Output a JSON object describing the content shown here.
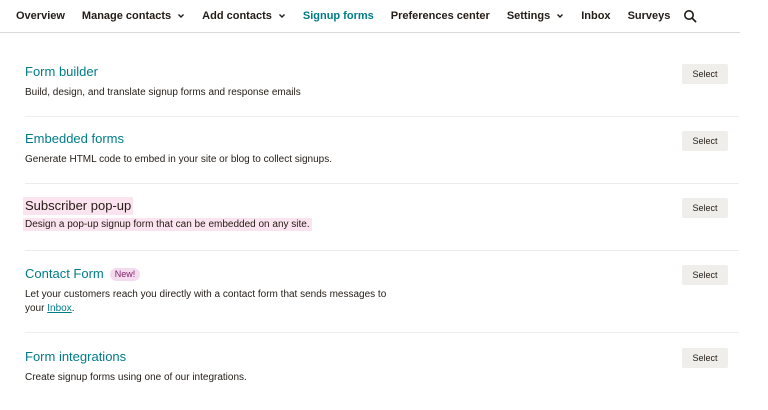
{
  "nav": {
    "items": [
      {
        "label": "Overview",
        "dropdown": false,
        "active": false
      },
      {
        "label": "Manage contacts",
        "dropdown": true,
        "active": false
      },
      {
        "label": "Add contacts",
        "dropdown": true,
        "active": false
      },
      {
        "label": "Signup forms",
        "dropdown": false,
        "active": true
      },
      {
        "label": "Preferences center",
        "dropdown": false,
        "active": false
      },
      {
        "label": "Settings",
        "dropdown": true,
        "active": false
      },
      {
        "label": "Inbox",
        "dropdown": false,
        "active": false
      },
      {
        "label": "Surveys",
        "dropdown": false,
        "active": false
      }
    ],
    "search_icon": "search-icon"
  },
  "forms": [
    {
      "title": "Form builder",
      "description": "Build, design, and translate signup forms and response emails",
      "button": "Select"
    },
    {
      "title": "Embedded forms",
      "description": "Generate HTML code to embed in your site or blog to collect signups.",
      "button": "Select"
    },
    {
      "title": "Subscriber pop-up",
      "description": "Design a pop-up signup form that can be embedded on any site.",
      "button": "Select",
      "highlighted": true
    },
    {
      "title": "Contact Form",
      "badge": "New!",
      "description_line1": "Let your customers reach you directly with a contact form that sends messages to",
      "description_line2_prefix": "your ",
      "description_link": "Inbox",
      "description_line2_suffix": ".",
      "button": "Select"
    },
    {
      "title": "Form integrations",
      "description": "Create signup forms using one of our integrations.",
      "button": "Select"
    }
  ],
  "colors": {
    "accent": "#007c89",
    "highlight": "#fbe3ef",
    "badge_bg": "#f4dbf0",
    "button_bg": "#efeeea"
  }
}
